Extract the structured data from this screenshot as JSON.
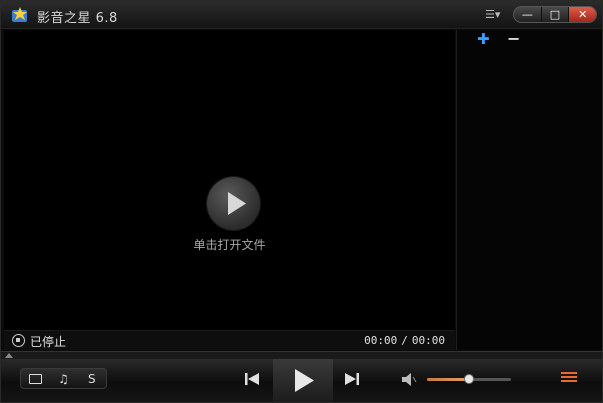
{
  "window": {
    "title": "影音之星 6.8",
    "icons": {
      "logo": "app-star-logo",
      "menu": "menu-list-icon",
      "minimize": "minimize-icon",
      "maximize": "maximize-icon",
      "close": "close-icon"
    }
  },
  "video": {
    "open_hint": "单击打开文件",
    "play_icon": "play-icon"
  },
  "playlist": {
    "add_icon": "plus-icon",
    "remove_icon": "minus-icon"
  },
  "status": {
    "state_text": "已停止",
    "current_time": "00:00",
    "separator": "/",
    "total_time": "00:00"
  },
  "controls": {
    "mode_buttons": [
      "screen-icon",
      "music-note-icon",
      "S"
    ],
    "music_glyph": "♫",
    "s_label": "S",
    "volume_level": 0.5
  },
  "colors": {
    "accent_blue": "#3b9dff",
    "close_red": "#c0392b",
    "volume_orange": "#d58a4a",
    "playlist_orange": "#e76b2a"
  }
}
